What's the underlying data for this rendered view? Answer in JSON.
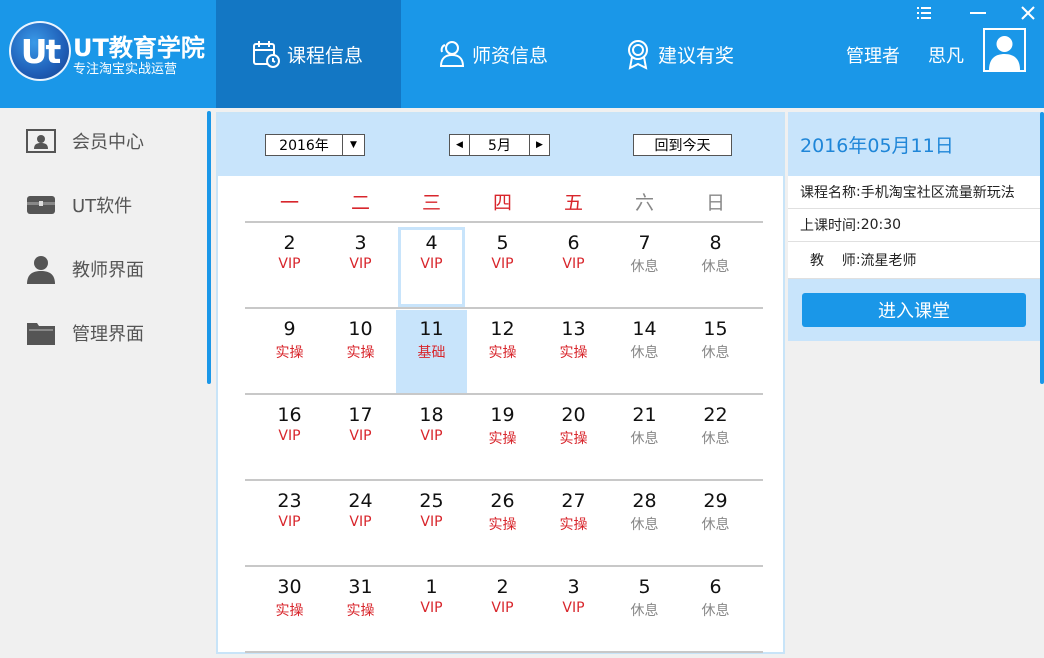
{
  "app": {
    "logo_badge": "Ut",
    "title": "UT教育学院",
    "subtitle": "专注淘宝实战运营"
  },
  "nav": {
    "tabs": [
      {
        "label": "课程信息",
        "icon": "calendar-clock-icon",
        "active": true
      },
      {
        "label": "师资信息",
        "icon": "users-icon",
        "active": false
      },
      {
        "label": "建议有奖",
        "icon": "award-icon",
        "active": false
      }
    ]
  },
  "user": {
    "role": "管理者",
    "name": "思凡",
    "avatar_icon": "user-avatar-icon"
  },
  "window_controls": {
    "menu_icon": "menu-icon",
    "minimize_icon": "minimize-icon",
    "close_icon": "close-icon"
  },
  "sidebar": {
    "items": [
      {
        "label": "会员中心",
        "icon": "id-card-icon"
      },
      {
        "label": "UT软件",
        "icon": "software-box-icon"
      },
      {
        "label": "教师界面",
        "icon": "person-icon"
      },
      {
        "label": "管理界面",
        "icon": "folder-icon"
      }
    ]
  },
  "calendar": {
    "year": "2016年",
    "month": "5月",
    "today_button": "回到今天",
    "weekdays": [
      "一",
      "二",
      "三",
      "四",
      "五",
      "六",
      "日"
    ],
    "weeks": [
      [
        {
          "day": "2",
          "tag": "VIP"
        },
        {
          "day": "3",
          "tag": "VIP"
        },
        {
          "day": "4",
          "tag": "VIP"
        },
        {
          "day": "5",
          "tag": "VIP"
        },
        {
          "day": "6",
          "tag": "VIP"
        },
        {
          "day": "7",
          "tag": "休息"
        },
        {
          "day": "8",
          "tag": "休息"
        }
      ],
      [
        {
          "day": "9",
          "tag": "实操"
        },
        {
          "day": "10",
          "tag": "实操"
        },
        {
          "day": "11",
          "tag": "基础"
        },
        {
          "day": "12",
          "tag": "实操"
        },
        {
          "day": "13",
          "tag": "实操"
        },
        {
          "day": "14",
          "tag": "休息"
        },
        {
          "day": "15",
          "tag": "休息"
        }
      ],
      [
        {
          "day": "16",
          "tag": "VIP"
        },
        {
          "day": "17",
          "tag": "VIP"
        },
        {
          "day": "18",
          "tag": "VIP"
        },
        {
          "day": "19",
          "tag": "实操"
        },
        {
          "day": "20",
          "tag": "实操"
        },
        {
          "day": "21",
          "tag": "休息"
        },
        {
          "day": "22",
          "tag": "休息"
        }
      ],
      [
        {
          "day": "23",
          "tag": "VIP"
        },
        {
          "day": "24",
          "tag": "VIP"
        },
        {
          "day": "25",
          "tag": "VIP"
        },
        {
          "day": "26",
          "tag": "实操"
        },
        {
          "day": "27",
          "tag": "实操"
        },
        {
          "day": "28",
          "tag": "休息"
        },
        {
          "day": "29",
          "tag": "休息"
        }
      ],
      [
        {
          "day": "30",
          "tag": "实操"
        },
        {
          "day": "31",
          "tag": "实操"
        },
        {
          "day": "1",
          "tag": "VIP"
        },
        {
          "day": "2",
          "tag": "VIP"
        },
        {
          "day": "3",
          "tag": "VIP"
        },
        {
          "day": "5",
          "tag": "休息"
        },
        {
          "day": "6",
          "tag": "休息"
        }
      ]
    ],
    "today": "4",
    "selected": "11"
  },
  "detail": {
    "date": "2016年05月11日",
    "course_label": "课程名称",
    "course_value": "手机淘宝社区流量新玩法",
    "time_label": "上课时间",
    "time_value": "20:30",
    "teacher_label": "教    师",
    "teacher_value": "流星老师",
    "enter_button": "进入课堂"
  },
  "colors": {
    "header": "#1a97e8",
    "active_tab": "#1377c4",
    "light_blue": "#c8e4fb",
    "red": "#d8262c",
    "gray": "#888888",
    "date_blue": "#1f86d8"
  }
}
